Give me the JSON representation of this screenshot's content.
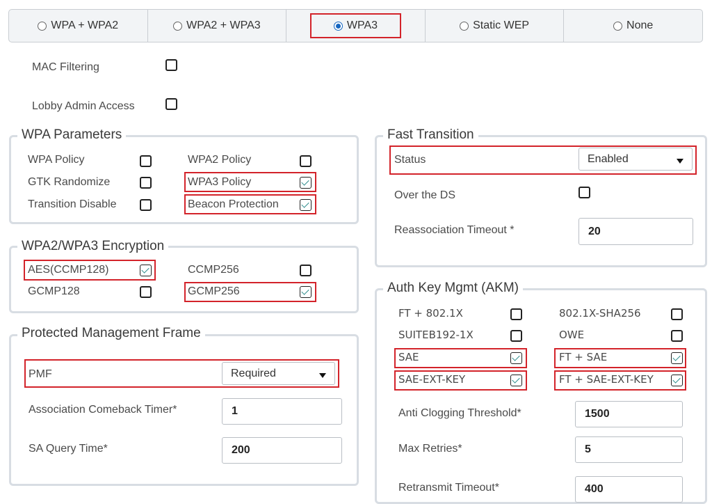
{
  "security_modes": [
    {
      "label": "WPA + WPA2",
      "selected": false
    },
    {
      "label": "WPA2 + WPA3",
      "selected": false
    },
    {
      "label": "WPA3",
      "selected": true
    },
    {
      "label": "Static WEP",
      "selected": false
    },
    {
      "label": "None",
      "selected": false
    }
  ],
  "general": {
    "mac_filtering": "MAC Filtering",
    "lobby_admin_access": "Lobby Admin Access"
  },
  "wpa_parameters": {
    "title": "WPA Parameters",
    "wpa_policy": "WPA Policy",
    "wpa2_policy": "WPA2 Policy",
    "gtk_randomize": "GTK Randomize",
    "wpa3_policy": "WPA3 Policy",
    "transition_disable": "Transition Disable",
    "beacon_protection": "Beacon Protection"
  },
  "encryption": {
    "title": "WPA2/WPA3 Encryption",
    "aes": "AES(CCMP128)",
    "ccmp256": "CCMP256",
    "gcmp128": "GCMP128",
    "gcmp256": "GCMP256"
  },
  "pmf": {
    "title": "Protected Management Frame",
    "pmf_label": "PMF",
    "pmf_value": "Required",
    "comeback_label": "Association Comeback Timer*",
    "comeback_value": "1",
    "sa_query_label": "SA Query Time*",
    "sa_query_value": "200"
  },
  "fast_transition": {
    "title": "Fast Transition",
    "status_label": "Status",
    "status_value": "Enabled",
    "over_ds": "Over the DS",
    "reassoc_label": "Reassociation Timeout *",
    "reassoc_value": "20"
  },
  "akm": {
    "title": "Auth Key Mgmt (AKM)",
    "ft_8021x": "FT + 802.1X",
    "dot1x_sha256": "802.1X-SHA256",
    "suiteb": "SUITEB192-1X",
    "owe": "OWE",
    "sae": "SAE",
    "ft_sae": "FT + SAE",
    "sae_ext": "SAE-EXT-KEY",
    "ft_sae_ext": "FT + SAE-EXT-KEY",
    "anti_clog_label": "Anti Clogging Threshold*",
    "anti_clog_value": "1500",
    "max_retries_label": "Max Retries*",
    "max_retries_value": "5",
    "retransmit_label": "Retransmit Timeout*",
    "retransmit_value": "400"
  },
  "colors": {
    "highlight": "#d3232a",
    "radio_selected": "#1565c0",
    "check": "#2b8a8a"
  }
}
